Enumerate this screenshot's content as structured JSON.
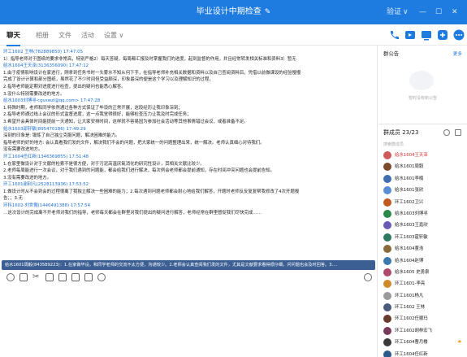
{
  "window": {
    "title": "毕业设计中期检查",
    "edit_icon": "pencil-icon",
    "controls": [
      "验证",
      "∨",
      "—",
      "☐",
      "✕"
    ],
    "accent": "#1e7be0"
  },
  "tabs": [
    {
      "label": "聊天",
      "active": true
    },
    {
      "label": "相册"
    },
    {
      "label": "文件"
    },
    {
      "label": "活动"
    },
    {
      "label": "设置 ∨"
    }
  ],
  "toolbar_icons": [
    "phone-icon",
    "video-icon",
    "screen-share-icon",
    "add-member-icon",
    "more-icon"
  ],
  "messages": [
    {
      "kind": "sender",
      "text": "环工1602 王林(782889850) 17:47:05"
    },
    {
      "kind": "text",
      "text": "1）指导老师对于图纸的要求非常高，特别严格2）每天答疑，每周都汇报及时掌握我们的进度，起到监督的作用，并且经常转发相关标准和资料3）暂无"
    },
    {
      "kind": "sender",
      "text": "给水1604王天泽(3136356090) 17:47:12"
    },
    {
      "kind": "text",
      "text": "1.由于疫情影响设计在家进行，刚拿到任务书时一头雾水不知从何下手，在指导老师补充相关数据和资料以及自己查阅资料后，凭借以前做课设的经验慢慢"
    },
    {
      "kind": "text",
      "text": "完成了设计计算和部分图纸，虽然花了不少时间但受益颇深，印象最深的便是这个学习以及理解知识的过程。"
    },
    {
      "kind": "text",
      "text": "2.指导老师能定期对进度进行检查，提出的疑问也能悉心解答。"
    },
    {
      "kind": "text",
      "text": "3.没什么特别需要改进的地方。"
    },
    {
      "kind": "sender",
      "text": "给水1603刘博寻<gvswzl@qq.com> 17:47:28"
    },
    {
      "kind": "text",
      "text": "1.特殊时期，老师和同学依然通过各种方式保证了毕设的正常开展，这段经历让我印象深刻；"
    },
    {
      "kind": "text",
      "text": "2.指导老师通过线上会议的形式监督进度，这一点我觉得很好，能够检查压力让我及时完成任务；"
    },
    {
      "kind": "text",
      "text": "3.希望开会具体时间能提前一天通知，让大家安排时间，这样就不容易因为参加社会活动等其他事情错过会议，或者准备不足。"
    },
    {
      "kind": "sender",
      "text": "给水1603邵轩敏(895470186) 17:49:29"
    },
    {
      "kind": "text",
      "text": "深刻的印象是: 锻炼了自己独立克服问题，解决困难的能力。"
    },
    {
      "kind": "text",
      "text": "指导老师的好的地方: 会认真看我们发的文件，解决我们不会的问题，把大家统一的问题整理出来，统一解决。老师认真细心对待我们。"
    },
    {
      "kind": "text",
      "text": "没有需要改进地方。"
    },
    {
      "kind": "sender",
      "text": "环工1604任红新(1346369855) 17:51:48"
    },
    {
      "kind": "text",
      "text": "1.在家里做设计对于文献的检索不是很方便，对于污泥高温厌氧消化的研究性设计，其相关文献比较少。"
    },
    {
      "kind": "text",
      "text": "2.老师每周能进行一次会议，对于我们遇到的问题能，都会给我们进行解决，每次例会老师都会提前通知，存在时间冲突问题也会提前告知。"
    },
    {
      "kind": "text",
      "text": "3.没有需要改进的地方。"
    },
    {
      "kind": "sender",
      "text": "环工1601谢利凡(2528113936) 17:53:52"
    },
    {
      "kind": "text",
      "text": "1.做设计时从不会到会的过程很离了我独立解决一些困难的能力；2.每次遇到问题老师都会耐心地给我们解答，开题时老师反反复复帮我修改了4次开题报"
    },
    {
      "kind": "text",
      "text": "告；；3.无"
    },
    {
      "kind": "sender",
      "text": "环科1602-刘世傲(1440491388) 17:57:54"
    },
    {
      "kind": "text",
      "text": "…这次设计的完成离不开老师对我们的指导，老师每天都会在群里对我们提出的疑问进行解答，老师经常在群里督促我们尽快完成……"
    }
  ],
  "reply_quote": "给水1601周毅(843589223)：1.在家做毕设，和同学老师的交流不太方便，沟通较少。2.老师会认真查阅我们发的文件，尤其是文献要求看得很仔细，问问题也会及时回答。3.…",
  "input_tools": [
    "emoji-icon",
    "gif-icon",
    "scissors-icon",
    "folder-icon",
    "image-icon",
    "red-packet-icon",
    "voice-icon",
    "more-tools-icon"
  ],
  "announcement": {
    "title": "群公告",
    "more": "更多",
    "empty": "暂时没有新公告"
  },
  "members": {
    "count_label": "群成员 23/23",
    "search_placeholder": "搜索群成员",
    "list": [
      {
        "name": "给水1604王天泽",
        "red": true,
        "color": "#d05a5a"
      },
      {
        "name": "给水1601周毅",
        "color": "#7a4a2a"
      },
      {
        "name": "给水1601李楠",
        "color": "#3f6fb0"
      },
      {
        "name": "给水1601张欣",
        "color": "#5a8fd8"
      },
      {
        "name": "环工1602卫兴",
        "color": "#c25a20"
      },
      {
        "name": "给水1603刘博寻",
        "color": "#2a8a4a"
      },
      {
        "name": "给水1603王嘉欣",
        "color": "#6b5bb5"
      },
      {
        "name": "环工1603霍轩敏",
        "color": "#2e7a60"
      },
      {
        "name": "给水1604董浩",
        "color": "#8a6a3a"
      },
      {
        "name": "给水1604赵博",
        "color": "#3a7ab0"
      },
      {
        "name": "给水1605 史勇泉",
        "color": "#b04a6a"
      },
      {
        "name": "环工1601-李亮",
        "color": "#d08a2a"
      },
      {
        "name": "环工1601杨凡",
        "color": "#9a9a9a"
      },
      {
        "name": "环工1602 王林",
        "color": "#4a5a7a"
      },
      {
        "name": "环工1602任顺玛",
        "color": "#6a3a2a"
      },
      {
        "name": "环工1602胡林宏飞",
        "color": "#7a3a5a"
      },
      {
        "name": "环工1604曹月楼",
        "color": "#3a3a3a",
        "star": true
      },
      {
        "name": "环工1604任红新",
        "color": "#2a5a8a"
      }
    ]
  }
}
